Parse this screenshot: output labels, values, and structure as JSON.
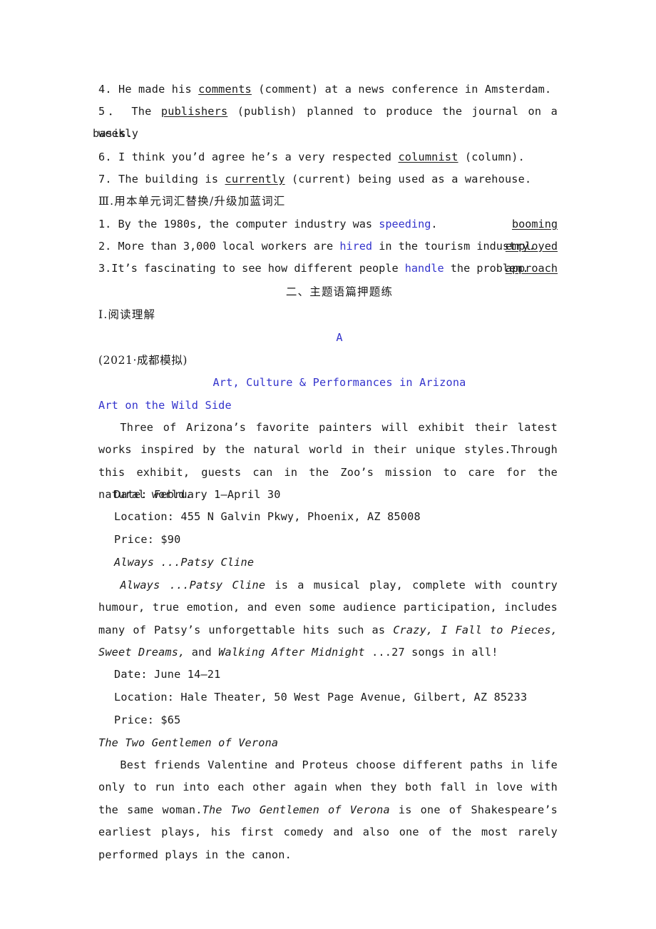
{
  "section_grammar": {
    "items": [
      {
        "number": "4.",
        "before": "He made his ",
        "answer": "comments",
        "after": " (comment) at a news conference in Amsterdam."
      },
      {
        "number": "5．",
        "before": "The ",
        "answer": "publishers",
        "after": " (publish) planned to produce the journal on a weekly",
        "continuation": "basis."
      },
      {
        "number": "6.",
        "before": "I think you’d agree he’s a very respected ",
        "answer": "columnist",
        "after": " (column)."
      },
      {
        "number": "7.",
        "before": "The building is ",
        "answer": "currently",
        "after": " (current) being used as a warehouse."
      }
    ]
  },
  "section_substitute": {
    "heading": "Ⅲ.用本单元词汇替换/升级加蓝词汇",
    "items": [
      {
        "number": "1.",
        "text_before": "By the 1980s, the computer industry was ",
        "highlight": "speeding",
        "text_after": ".",
        "answer": "booming"
      },
      {
        "number": "2.",
        "text_before": "More than 3,000 local workers are ",
        "highlight": "hired",
        "text_after": " in the tourism industry.",
        "answer": "employed"
      },
      {
        "number": "3.",
        "text_before": "It’s fascinating to see how different people ",
        "highlight": "handle",
        "text_after": " the problem.",
        "answer": "approach"
      }
    ]
  },
  "section_two": {
    "heading": "二、主题语篇押题练",
    "subheading": "Ⅰ.阅读理解",
    "passage_label": "A",
    "source": "(2021·成都模拟)",
    "title": "Art, Culture & Performances in Arizona"
  },
  "event1": {
    "title": "Art on the Wild Side",
    "body": "Three of Arizona’s favorite painters will exhibit their latest works inspired by the natural world in their unique styles.Through this exhibit, guests can in the Zoo’s mission to care for the natural world.",
    "date": "Date: February 1—April 30",
    "location": "Location: 455 N Galvin Pkwy, Phoenix, AZ 85008",
    "price": "Price: $90"
  },
  "event2": {
    "title": "Always ...Patsy Cline",
    "body_parts": {
      "t1": "Always ...Patsy Cline",
      "p1": " is a musical play, complete with country humour, true emotion, and even some audience participation, includes many of Patsy’s unforgettable hits such as ",
      "t2": "Crazy, I Fall to Pieces, Sweet Dreams,",
      "p2": " and ",
      "t3": "Walking After Midnight",
      "p3": " ...27 songs in all!"
    },
    "date": "Date: June 14—21",
    "location": "Location: Hale Theater, 50 West Page Avenue, Gilbert, AZ 85233",
    "price": "Price: $65"
  },
  "event3": {
    "title": "The Two Gentlemen of Verona",
    "body_parts": {
      "p1": "Best friends Valentine and Proteus choose different paths in life only to run into each other again when they both fall in love with the same woman.",
      "t1": "The Two Gentlemen of Verona",
      "p2": " is one of Shakespeare’s earliest plays, his first comedy and also one of the most rarely performed plays in the canon."
    }
  },
  "colors": {
    "highlight_blue": "#3333cc",
    "text": "#1a1a1a",
    "background": "#ffffff"
  }
}
